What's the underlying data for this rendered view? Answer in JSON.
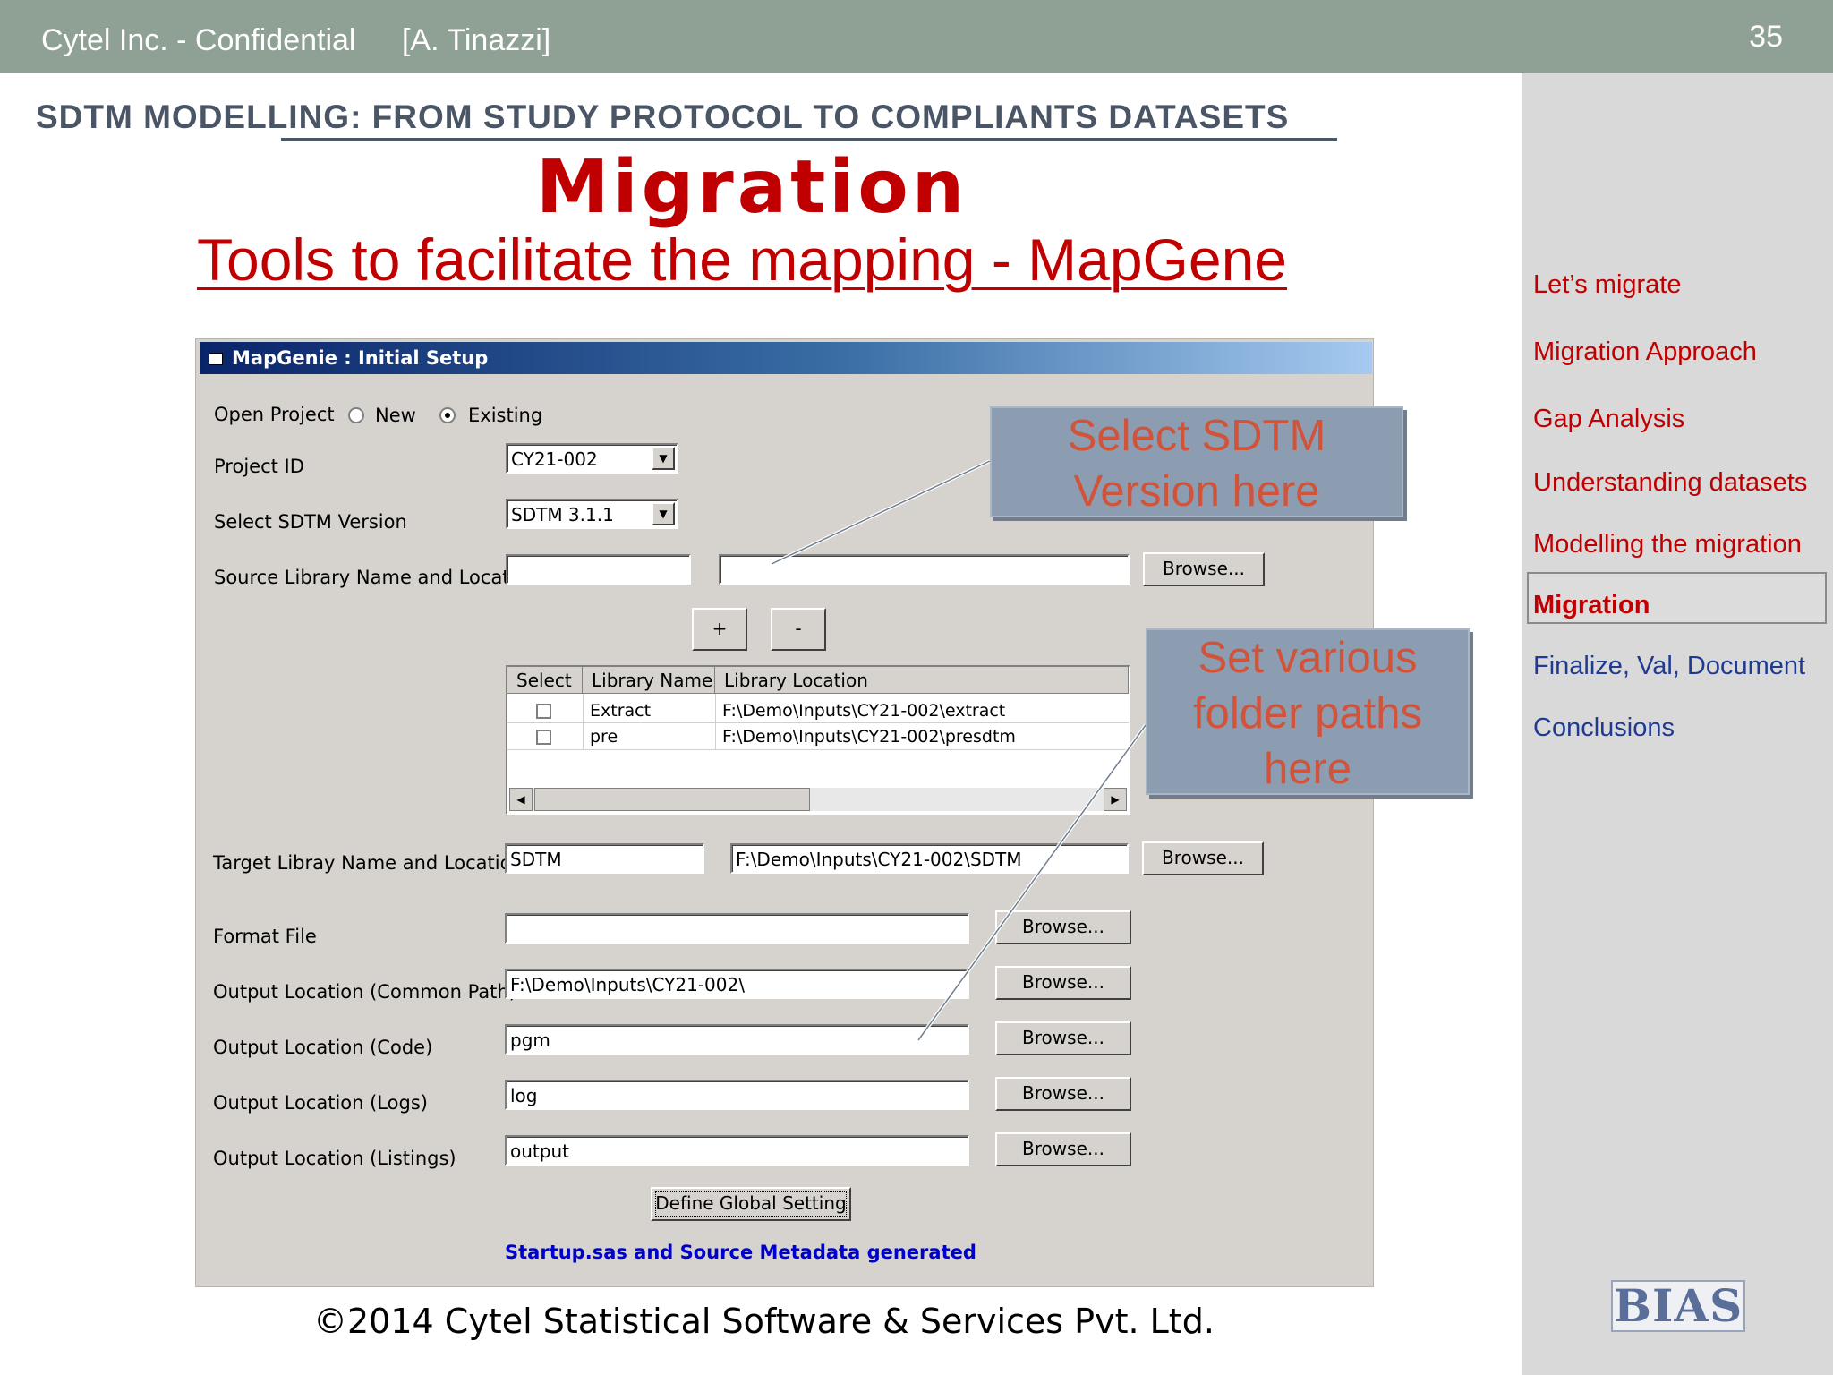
{
  "header": {
    "company": "Cytel Inc. - Confidential",
    "author": "[A. Tinazzi]",
    "page_number": "35"
  },
  "heading": "SDTM MODELLING: FROM STUDY PROTOCOL TO COMPLIANTS DATASETS",
  "title": "Migration",
  "subtitle": "Tools to facilitate the mapping - MapGene",
  "nav": {
    "items": [
      {
        "label": "Let’s migrate",
        "color": "#c00000"
      },
      {
        "label": "Migration Approach",
        "color": "#c00000"
      },
      {
        "label": "Gap Analysis",
        "color": "#c00000"
      },
      {
        "label": "Understanding datasets",
        "color": "#c00000"
      },
      {
        "label": "Modelling the migration",
        "color": "#c00000"
      },
      {
        "label": "Migration",
        "color": "#c00000",
        "active": true
      },
      {
        "label": "Finalize, Val, Document",
        "color": "#1f3a8f"
      },
      {
        "label": "Conclusions",
        "color": "#1f3a8f"
      }
    ]
  },
  "window": {
    "title": "MapGenie : Initial Setup",
    "open_project": {
      "label": "Open Project",
      "option_new": "New",
      "option_existing": "Existing",
      "selected": "Existing"
    },
    "project_id": {
      "label": "Project ID",
      "value": "CY21-002"
    },
    "sdtm_version": {
      "label": "Select SDTM Version",
      "value": "SDTM 3.1.1"
    },
    "source_library": {
      "label": "Source Library Name and Location",
      "name": "",
      "location": "",
      "browse": "Browse..."
    },
    "add_button": "+",
    "remove_button": "-",
    "grid": {
      "columns": [
        "Select",
        "Library Name",
        "Library Location"
      ],
      "rows": [
        {
          "selected": false,
          "name": "Extract",
          "location": "F:\\Demo\\Inputs\\CY21-002\\extract"
        },
        {
          "selected": false,
          "name": "pre",
          "location": "F:\\Demo\\Inputs\\CY21-002\\presdtm"
        }
      ]
    },
    "target_library": {
      "label": "Target Libray Name and  Location",
      "name": "SDTM",
      "location": "F:\\Demo\\Inputs\\CY21-002\\SDTM",
      "browse": "Browse..."
    },
    "format_file": {
      "label": "Format File",
      "value": "",
      "browse": "Browse..."
    },
    "output_common": {
      "label": "Output Location (Common Path)",
      "value": "F:\\Demo\\Inputs\\CY21-002\\",
      "browse": "Browse..."
    },
    "output_code": {
      "label": "Output Location (Code)",
      "value": "pgm",
      "browse": "Browse..."
    },
    "output_logs": {
      "label": "Output Location (Logs)",
      "value": "log",
      "browse": "Browse..."
    },
    "output_listings": {
      "label": "Output Location (Listings)",
      "value": "output",
      "browse": "Browse..."
    },
    "define_button": "Define Global Setting",
    "status": "Startup.sas and Source Metadata generated"
  },
  "callouts": {
    "sdtm": {
      "line1": "Select SDTM",
      "line2": "Version here"
    },
    "folders": {
      "line1": "Set various",
      "line2": "folder paths",
      "line3": "here"
    }
  },
  "footer": "©2014 Cytel Statistical Software & Services Pvt. Ltd.",
  "logo": "BIAS"
}
